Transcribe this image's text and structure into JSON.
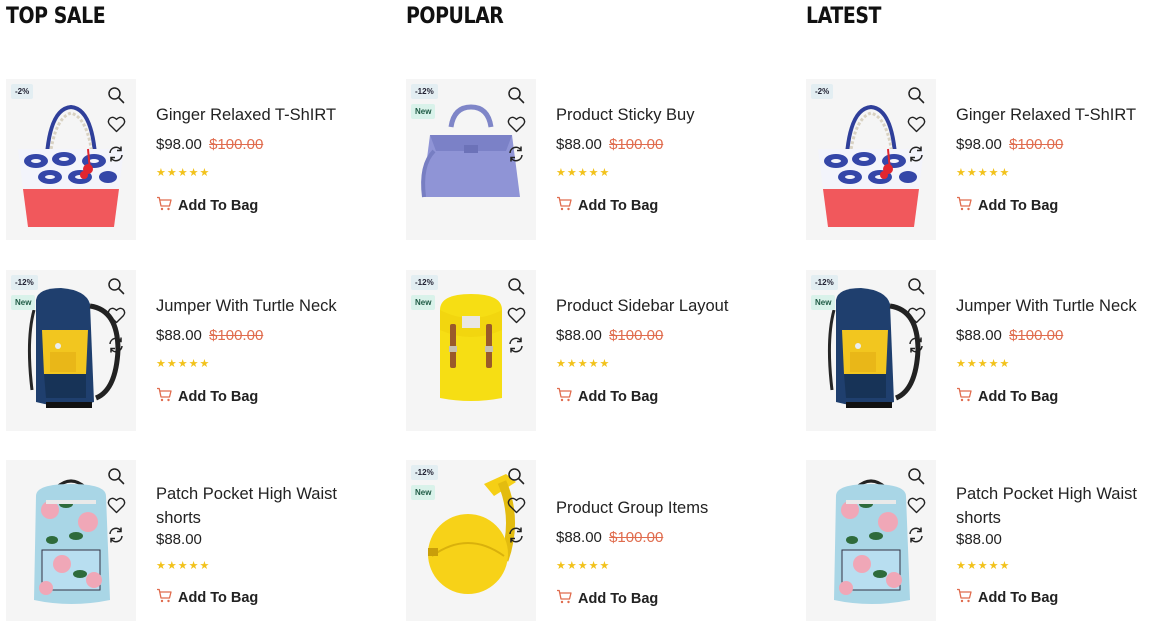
{
  "colors": {
    "accent": "#e06c4e",
    "star": "#f2c21b",
    "badge_sale_bg": "#e3eef2",
    "badge_new_bg": "#d9f2ea"
  },
  "icons": {
    "quick_view": "magnifier-icon",
    "wishlist": "heart-icon",
    "compare": "refresh-icon",
    "cart": "cart-icon"
  },
  "columns": [
    {
      "title": "TOP SALE",
      "products": [
        {
          "name": "Ginger Relaxed T-ShIRT",
          "price": "$98.00",
          "old_price": "$100.00",
          "discount": "-2%",
          "badge_new": "",
          "rating": 5,
          "cta": "Add To Bag",
          "image": "tote-bag"
        },
        {
          "name": "Jumper With Turtle Neck",
          "price": "$88.00",
          "old_price": "$100.00",
          "discount": "-12%",
          "badge_new": "New",
          "rating": 5,
          "cta": "Add To Bag",
          "image": "hiking-backpack"
        },
        {
          "name": "Patch Pocket High Waist shorts",
          "price": "$88.00",
          "old_price": "",
          "discount": "",
          "badge_new": "",
          "rating": 5,
          "cta": "Add To Bag",
          "image": "floral-backpack"
        }
      ]
    },
    {
      "title": "POPULAR",
      "products": [
        {
          "name": "Product Sticky Buy",
          "price": "$88.00",
          "old_price": "$100.00",
          "discount": "-12%",
          "badge_new": "New",
          "rating": 5,
          "cta": "Add To Bag",
          "image": "purple-handbag"
        },
        {
          "name": "Product Sidebar Layout",
          "price": "$88.00",
          "old_price": "$100.00",
          "discount": "-12%",
          "badge_new": "New",
          "rating": 5,
          "cta": "Add To Bag",
          "image": "yellow-backpack"
        },
        {
          "name": "Product Group Items",
          "price": "$88.00",
          "old_price": "$100.00",
          "discount": "-12%",
          "badge_new": "New",
          "rating": 5,
          "cta": "Add To Bag",
          "image": "yellow-round-bag"
        }
      ]
    },
    {
      "title": "LATEST",
      "products": [
        {
          "name": "Ginger Relaxed T-ShIRT",
          "price": "$98.00",
          "old_price": "$100.00",
          "discount": "-2%",
          "badge_new": "",
          "rating": 5,
          "cta": "Add To Bag",
          "image": "tote-bag"
        },
        {
          "name": "Jumper With Turtle Neck",
          "price": "$88.00",
          "old_price": "$100.00",
          "discount": "-12%",
          "badge_new": "New",
          "rating": 5,
          "cta": "Add To Bag",
          "image": "hiking-backpack"
        },
        {
          "name": "Patch Pocket High Waist shorts",
          "price": "$88.00",
          "old_price": "",
          "discount": "",
          "badge_new": "",
          "rating": 5,
          "cta": "Add To Bag",
          "image": "floral-backpack"
        }
      ]
    }
  ]
}
